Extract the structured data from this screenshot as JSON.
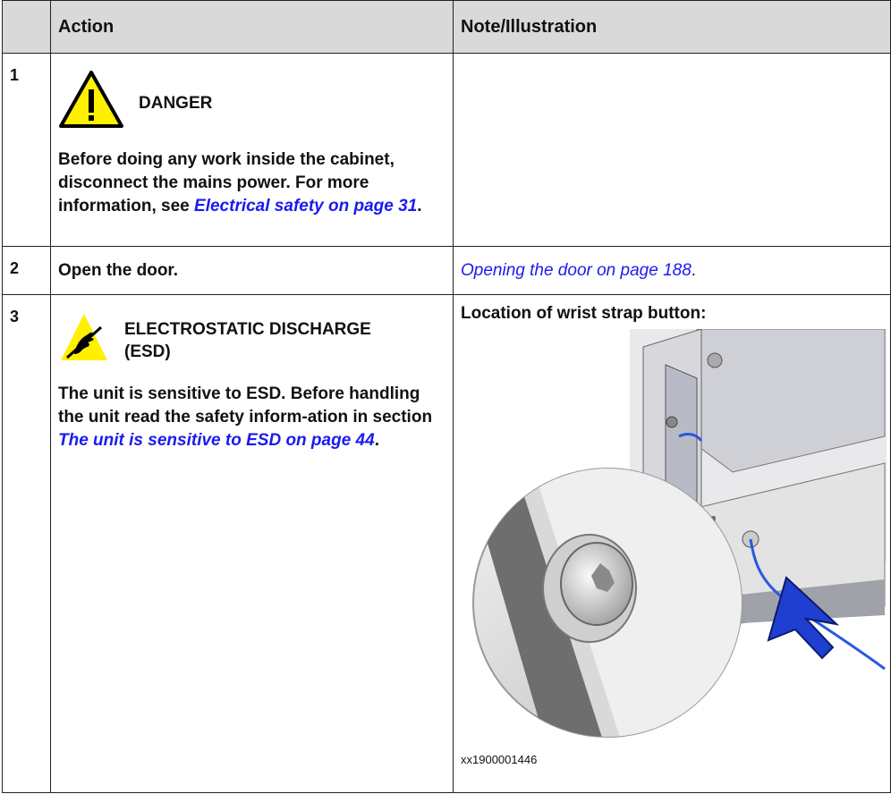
{
  "header": {
    "action": "Action",
    "note": "Note/Illustration"
  },
  "rows": [
    {
      "num": "1",
      "hazard_title": "DANGER",
      "text_before": "Before doing any work inside the cabinet, disconnect the mains power. For more information, see ",
      "link": "Electrical safety on page 31",
      "text_after": "."
    },
    {
      "num": "2",
      "action": "Open the door.",
      "note_link": "Opening the door on page 188",
      "note_after": "."
    },
    {
      "num": "3",
      "hazard_title_1": "ELECTROSTATIC DISCHARGE",
      "hazard_title_2": "(ESD)",
      "text_before": "The unit is sensitive to ESD. Before handling the unit read the safety inform-ation in section ",
      "link": "The unit is sensitive to ESD on page 44",
      "text_after": ".",
      "note_title": "Location of wrist strap button:",
      "caption": "xx1900001446"
    }
  ],
  "colors": {
    "link": "#1a1af0",
    "header_bg": "#d9d9d9",
    "danger_yellow": "#ffef00",
    "arrow_blue": "#1f3fd0"
  }
}
